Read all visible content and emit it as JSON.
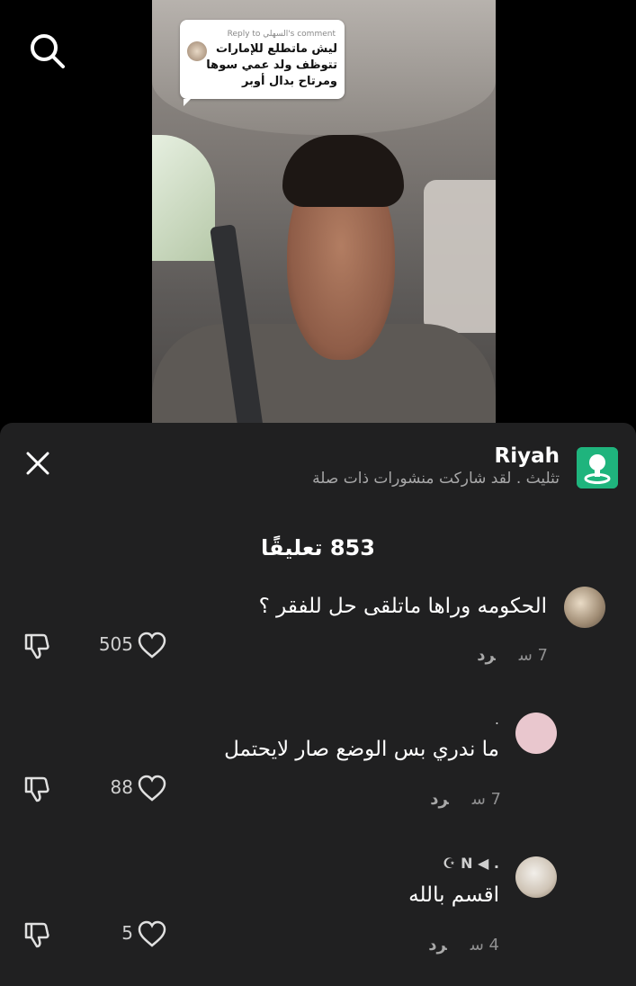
{
  "video": {
    "reply_label": "Reply to السهلي's comment",
    "reply_text": "ليش ماتطلع للإمارات تتوظف ولد عمي سوها ومرتاح بدال أوبر"
  },
  "sheet": {
    "title": "Riyah",
    "subtitle": "تثليث . لقد شاركت منشورات ذات صلة",
    "comment_count": "853 تعليقًا",
    "accent": "#1fb47d"
  },
  "comments": [
    {
      "user": "",
      "text": "الحكومه وراها ماتلقى حل للفقر ؟",
      "time": "7 س",
      "reply": "رد",
      "likes": "505"
    },
    {
      "user": ".",
      "text": "ما ندري بس الوضع صار لايحتمل",
      "time": "7 س",
      "reply": "رد",
      "likes": "88"
    },
    {
      "user": "☪ N ◀ .",
      "text": "اقسم بالله",
      "time": "4 س",
      "reply": "رد",
      "likes": "5"
    }
  ]
}
